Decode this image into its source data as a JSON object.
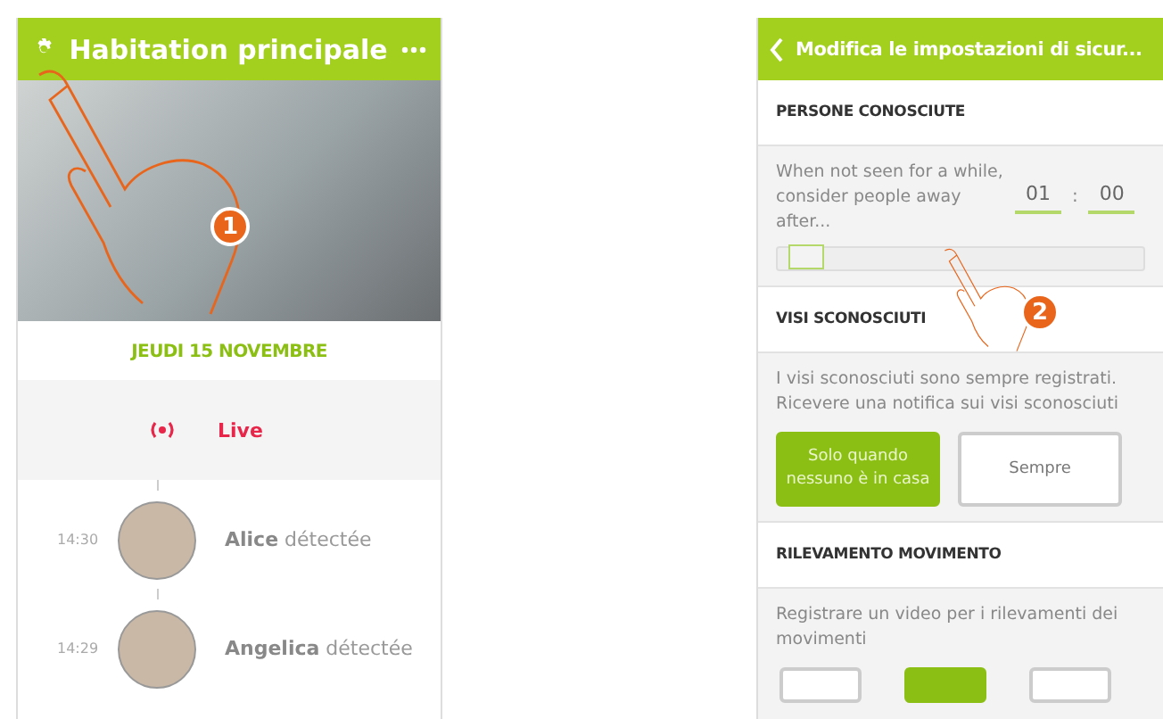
{
  "home_screen": {
    "title": "Habitation principale",
    "date": "JEUDI 15 NOVEMBRE",
    "live": {
      "label": "Live"
    },
    "events": [
      {
        "time": "14:30",
        "text": "**Alice** détectée"
      },
      {
        "time": "14:29",
        "text": "**Angelica** détectée"
      }
    ]
  },
  "settings_screen": {
    "title": "Modifica le impostazioni di sicur...",
    "known_people": {
      "heading": "PERSONE CONOSCIUTE",
      "description": "When not seen for a while, consider people away after...",
      "hours": "01",
      "separator": ":",
      "minutes": "00",
      "slider": {
        "level": 0.03
      }
    },
    "unknown_faces": {
      "heading": "VISI SCONOSCIUTI",
      "description": "I visi sconosciuti sono sempre registrati. Ricevere una notifica sui visi sconosciuti",
      "options": [
        {
          "label": "Solo quando nessuno è in casa",
          "selected": true
        },
        {
          "label": "Sempre",
          "selected": false
        }
      ]
    },
    "motion": {
      "heading": "RILEVAMENTO MOVIMENTO",
      "description": "Registrare un video per i rilevamenti dei movimenti",
      "options": [
        {
          "selected": false
        },
        {
          "selected": true
        },
        {
          "selected": false
        }
      ]
    }
  },
  "steps": [
    {
      "number": "1"
    },
    {
      "number": "2"
    }
  ]
}
